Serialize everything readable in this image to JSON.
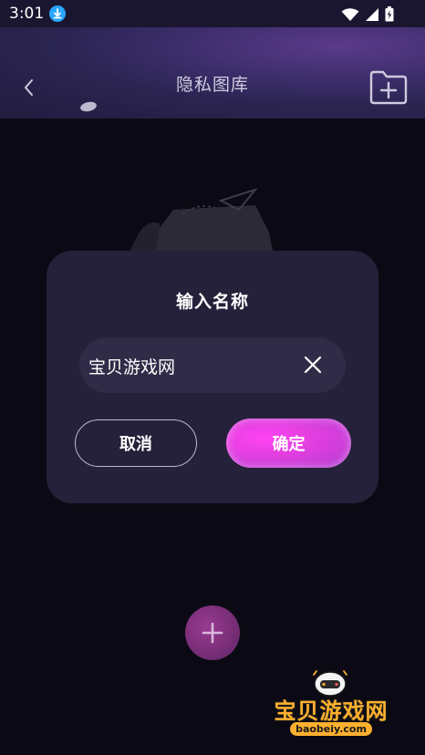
{
  "status_bar": {
    "time": "3:01"
  },
  "header": {
    "title": "隐私图库"
  },
  "dialog": {
    "title": "输入名称",
    "input_value": "宝贝游戏网",
    "cancel_label": "取消",
    "confirm_label": "确定"
  },
  "watermark": {
    "name": "宝贝游戏网",
    "url": "baobeiy.com"
  },
  "colors": {
    "accent_pink": "#e33fe0",
    "dialog_bg": "#25213a",
    "background": "#0b0a14"
  },
  "icons": {
    "back": "chevron-left-icon",
    "folder_add": "folder-add-icon",
    "clear": "close-icon",
    "fab": "plus-icon",
    "download": "download-icon",
    "wifi": "wifi-icon",
    "signal": "signal-icon",
    "battery": "battery-icon"
  }
}
